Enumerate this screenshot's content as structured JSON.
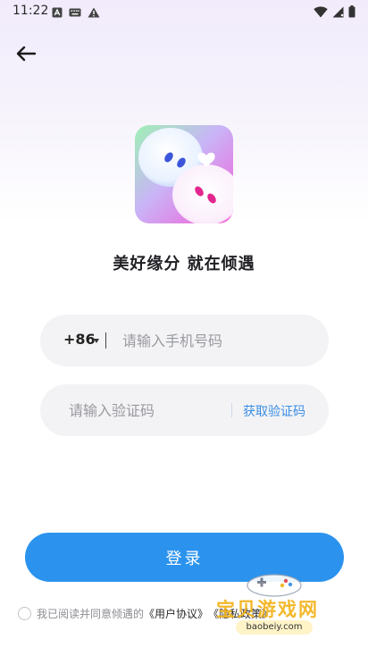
{
  "status_bar": {
    "time": "11:22",
    "left_icons": [
      "notification-a-icon",
      "keyboard-icon",
      "warning-icon"
    ],
    "right_icons": [
      "wifi-icon",
      "signal-icon",
      "battery-icon"
    ]
  },
  "nav": {
    "back_icon": "arrow-left-icon"
  },
  "app": {
    "slogan": "美好缘分 就在倾遇"
  },
  "login_form": {
    "country_code": "+86",
    "phone_placeholder": "请输入手机号码",
    "code_placeholder": "请输入验证码",
    "get_code_label": "获取验证码",
    "login_label": "登录"
  },
  "agreement": {
    "prefix": "我已阅读并同意倾遇的",
    "user_agreement": "《用户协议》",
    "privacy_policy": "《隐私政策》"
  },
  "watermark": {
    "text": "宝贝游戏网",
    "url": "baobeiy.com"
  },
  "colors": {
    "primary": "#2b93ee",
    "link": "#3a8ee6",
    "field_bg": "#f3f3f5"
  }
}
